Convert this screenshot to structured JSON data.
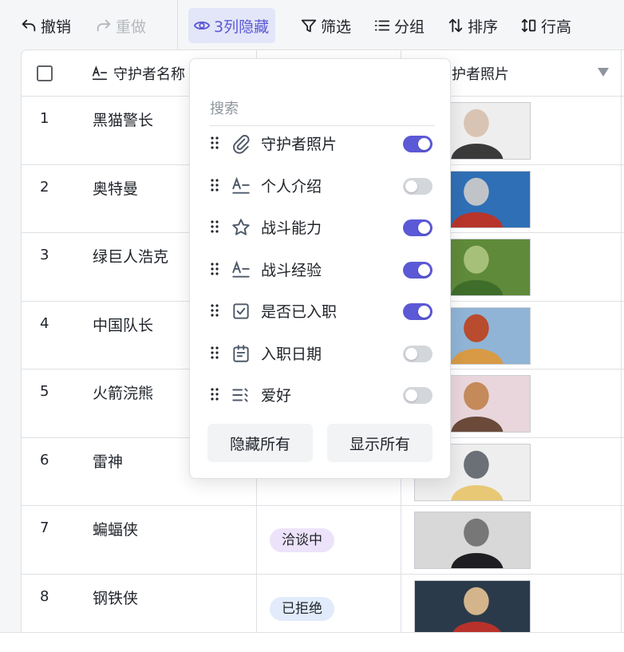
{
  "toolbar": {
    "undo_label": "撤销",
    "redo_label": "重做",
    "hidden_label": "3列隐藏",
    "filter_label": "筛选",
    "group_label": "分组",
    "sort_label": "排序",
    "row_height_label": "行高"
  },
  "table": {
    "columns": [
      {
        "label": "守护者名称",
        "icon": "text-field-icon"
      },
      {
        "label": "",
        "icon": ""
      },
      {
        "label": "守护者照片",
        "icon": "dropdown-arrow-icon"
      }
    ],
    "visible_partial_header": "护者照片",
    "rows": [
      {
        "num": "1",
        "name": "黑猫警长",
        "tag": ""
      },
      {
        "num": "2",
        "name": "奥特曼",
        "tag": ""
      },
      {
        "num": "3",
        "name": "绿巨人浩克",
        "tag": ""
      },
      {
        "num": "4",
        "name": "中国队长",
        "tag": ""
      },
      {
        "num": "5",
        "name": "火箭浣熊",
        "tag": ""
      },
      {
        "num": "6",
        "name": "雷神",
        "tag": ""
      },
      {
        "num": "7",
        "name": "蝙蝠侠",
        "tag": "洽谈中"
      },
      {
        "num": "8",
        "name": "钢铁侠",
        "tag": "已拒绝"
      }
    ],
    "tag_colors": {
      "洽谈中": {
        "bg": "#ece3fb",
        "fg": "#1f2329"
      },
      "已拒绝": {
        "bg": "#e1ebfb",
        "fg": "#1f2329"
      }
    }
  },
  "popup": {
    "search_placeholder": "搜索",
    "fields": [
      {
        "label": "守护者照片",
        "icon": "attachment-icon",
        "visible": true
      },
      {
        "label": "个人介绍",
        "icon": "text-field-icon",
        "visible": false
      },
      {
        "label": "战斗能力",
        "icon": "star-icon",
        "visible": true
      },
      {
        "label": "战斗经验",
        "icon": "text-field-icon",
        "visible": true
      },
      {
        "label": "是否已入职",
        "icon": "checkbox-icon",
        "visible": true
      },
      {
        "label": "入职日期",
        "icon": "calendar-icon",
        "visible": false
      },
      {
        "label": "爱好",
        "icon": "multi-select-icon",
        "visible": false
      }
    ],
    "hide_all_label": "隐藏所有",
    "show_all_label": "显示所有"
  },
  "colors": {
    "accent": "#5b59d6",
    "toggle_off": "#d3d6db",
    "toolbar_bg": "#f5f6f7"
  }
}
